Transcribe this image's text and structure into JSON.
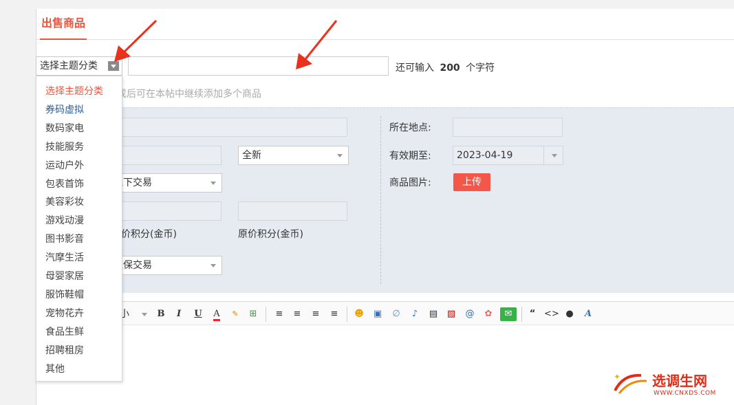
{
  "tabs": {
    "active": "出售商品"
  },
  "category_select": {
    "value": "选择主题分类"
  },
  "char_counter": {
    "prefix": "还可输入",
    "count": "200",
    "suffix": "个字符"
  },
  "hint_text": "成后可在本帖中继续添加多个商品",
  "form": {
    "condition_select": "全新",
    "trade_method": "线下交易",
    "original_price_label": "原价积分(金币)",
    "price_label_partial": "价积分(金币)",
    "guarantee_trade": "担保交易",
    "location_label": "所在地点:",
    "expiry_label": "有效期至:",
    "expiry_value": "2023-04-19",
    "image_label": "商品图片:",
    "upload_button": "上传"
  },
  "toolbar": {
    "font_size": "小",
    "bold": "B",
    "italic": "I",
    "underline": "U",
    "font_color": "A",
    "quote": "“",
    "code": "<>",
    "superscript": "A"
  },
  "dropdown": {
    "items": [
      "选择主题分类",
      "券码虚拟",
      "数码家电",
      "技能服务",
      "运动户外",
      "包表首饰",
      "美容彩妆",
      "游戏动漫",
      "图书影音",
      "汽摩生活",
      "母婴家居",
      "服饰鞋帽",
      "宠物花卉",
      "食品生鲜",
      "招聘租房",
      "其他"
    ]
  },
  "watermark": {
    "name": "选调生网",
    "url": "WWW.CNXDS.COM"
  },
  "colors": {
    "accent": "#f0533b",
    "form_bg": "#e5ebf1",
    "arrow_red": "#e8321e",
    "upload": "#f2574a"
  }
}
